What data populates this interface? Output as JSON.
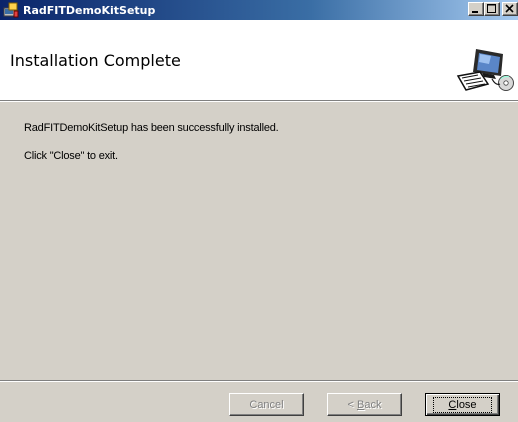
{
  "window": {
    "title": "RadFITDemoKitSetup",
    "icon": "installer-icon"
  },
  "caption_buttons": [
    "minimize-icon",
    "maximize-icon",
    "close-icon"
  ],
  "banner": {
    "title": "Installation Complete",
    "art": "computer-with-cd-icon"
  },
  "messages": {
    "line1": "RadFITDemoKitSetup has been successfully installed.",
    "line2": "Click \"Close\" to exit."
  },
  "buttons": {
    "cancel": "Cancel",
    "back_prefix": "< ",
    "back_mnemonic": "B",
    "back_rest": "ack",
    "close_mnemonic": "C",
    "close_rest": "lose"
  },
  "colors": {
    "dialog_bg": "#d4d0c8",
    "titlebar_start": "#0a246a",
    "titlebar_end": "#a6caf0",
    "disabled_text": "#808080"
  }
}
